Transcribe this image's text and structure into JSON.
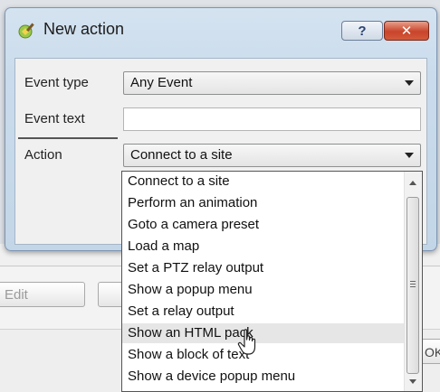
{
  "dialog": {
    "title": "New action",
    "help_label": "?",
    "close_label": "✕",
    "icon": "wand-icon"
  },
  "form": {
    "event_type_label": "Event type",
    "event_type_value": "Any Event",
    "event_text_label": "Event text",
    "event_text_value": "",
    "action_label": "Action",
    "action_value": "Connect to a site"
  },
  "dropdown": {
    "options": [
      "Connect to a site",
      "Perform an animation",
      "Goto a camera preset",
      "Load a map",
      "Set a PTZ relay output",
      "Show a popup menu",
      "Set a relay output",
      "Show an HTML pack",
      "Show a block of text",
      "Show a device popup menu"
    ],
    "hovered_index": 7
  },
  "background": {
    "edit_label": "Edit",
    "ok_label": "OK"
  },
  "colors": {
    "dialog_frame": "#c9dbec",
    "close_button": "#c9442a",
    "hover_row": "#e6e6e6"
  }
}
